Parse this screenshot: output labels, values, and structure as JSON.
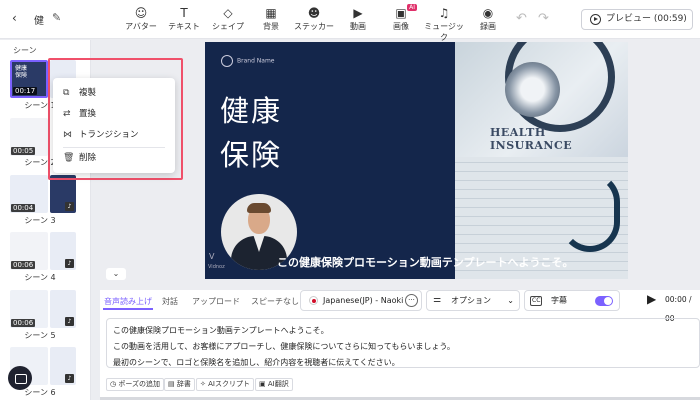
{
  "header": {
    "project_name": "健",
    "tools": [
      {
        "label": "アバター",
        "icon": "avatar-icon",
        "glyph": "☺"
      },
      {
        "label": "テキスト",
        "icon": "text-icon",
        "glyph": "T"
      },
      {
        "label": "シェイプ",
        "icon": "shape-icon",
        "glyph": "◇"
      },
      {
        "label": "背景",
        "icon": "background-icon",
        "glyph": "▦"
      },
      {
        "label": "ステッカー",
        "icon": "sticker-icon",
        "glyph": "☻"
      },
      {
        "label": "動画",
        "icon": "video-icon",
        "glyph": "▶"
      },
      {
        "label": "画像",
        "icon": "image-icon",
        "glyph": "▣",
        "badge": "AI"
      },
      {
        "label": "ミュージック",
        "icon": "music-icon",
        "glyph": "♫"
      },
      {
        "label": "録画",
        "icon": "record-icon",
        "glyph": "◉"
      }
    ],
    "preview_label": "プレビュー (00:59)"
  },
  "sidebar": {
    "title": "シーン",
    "scenes": [
      {
        "label": "シーン 1",
        "duration": "00:17",
        "thumb_text": "健康 保険"
      },
      {
        "label": "シーン 2",
        "duration": "00:05"
      },
      {
        "label": "シーン 3",
        "duration": "00:04"
      },
      {
        "label": "シーン 4",
        "duration": "00:06"
      },
      {
        "label": "シーン 5",
        "duration": "00:06"
      },
      {
        "label": "シーン 6"
      }
    ]
  },
  "context_menu": {
    "items": [
      {
        "label": "複製",
        "icon": "duplicate-icon",
        "glyph": "⧉"
      },
      {
        "label": "置換",
        "icon": "replace-icon",
        "glyph": "⇄"
      },
      {
        "label": "トランジション",
        "icon": "transition-icon",
        "glyph": "⋈"
      },
      {
        "label": "削除",
        "icon": "trash-icon",
        "glyph": "🗑"
      }
    ]
  },
  "canvas": {
    "brand": "Brand Name",
    "title": "健康 保険",
    "health_text": "HEALTH INSURANCE",
    "subtitle": "この健康保険プロモーション動画テンプレートへようこそ。",
    "watermark": "Vidnoz"
  },
  "panel": {
    "tabs": [
      "音声読み上げ",
      "対話",
      "アップロード",
      "スピーチなし"
    ],
    "voice": "Japanese(JP) - Naoki",
    "options_label": "オプション",
    "subtitle_label": "字幕",
    "time": "00:00 / 00",
    "script_lines": [
      "この健康保険プロモーション動画テンプレートへようこそ。",
      "この動画を活用して、お客様にアプローチし、健康保険についてさらに知ってもらいましょう。",
      "最初のシーンで、ロゴと保険名を追加し、紹介内容を視聴者に伝えてください。"
    ],
    "chips": [
      "ポーズの追加",
      "辞書",
      "AIスクリプト",
      "AI翻訳"
    ]
  },
  "colors": {
    "accent": "#7b61ff",
    "highlight": "#f0506a",
    "canvas_bg": "#14264b"
  }
}
